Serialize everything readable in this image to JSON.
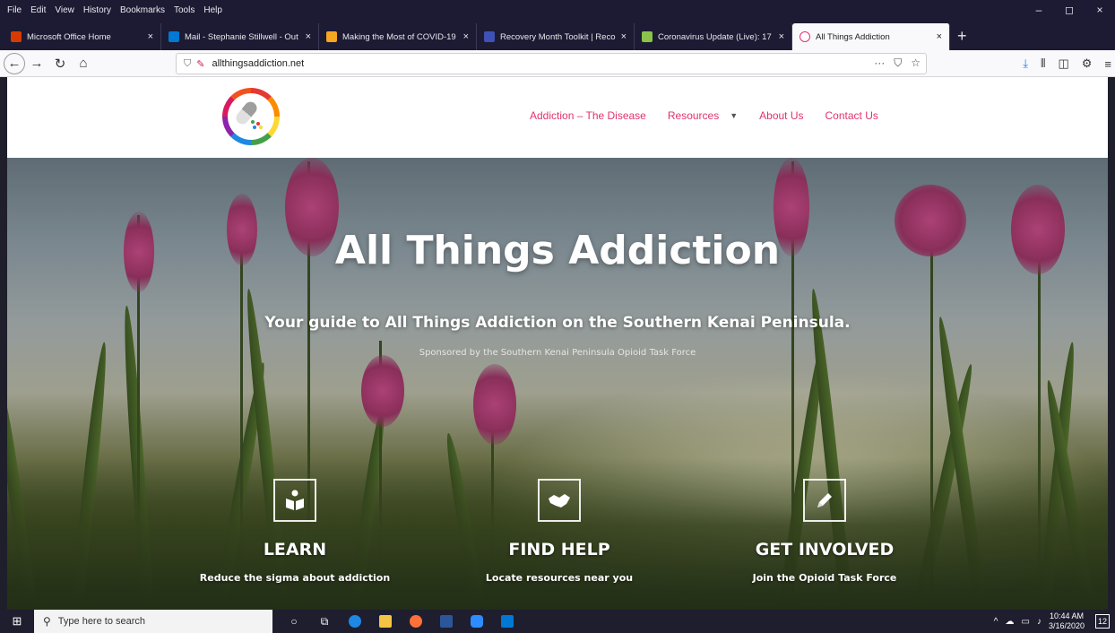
{
  "menubar": {
    "items": [
      "File",
      "Edit",
      "View",
      "History",
      "Bookmarks",
      "Tools",
      "Help"
    ],
    "controls": [
      "–",
      "◻",
      "×"
    ]
  },
  "tabs": [
    {
      "label": "Microsoft Office Home",
      "color": "#d83b01"
    },
    {
      "label": "Mail - Stephanie Stillwell - Out",
      "color": "#0078d4"
    },
    {
      "label": "Making the Most of COVID-19",
      "color": "#f5a623"
    },
    {
      "label": "Recovery Month Toolkit | Reco",
      "color": "#3f51b5"
    },
    {
      "label": "Coronavirus Update (Live): 17",
      "color": "#8bc34a"
    },
    {
      "label": "All Things Addiction",
      "color": "#ffffff",
      "active": true
    }
  ],
  "navbar": {
    "url": "allthingsaddiction.net",
    "url_right_icons": [
      "···",
      "⛉",
      "☆"
    ]
  },
  "site": {
    "nav": {
      "item1": "Addiction – The Disease",
      "item2": "Resources",
      "item3": "About Us",
      "item4": "Contact Us"
    },
    "hero": {
      "title": "All Things Addiction",
      "subtitle": "Your guide to All Things Addiction on the Southern Kenai Peninsula.",
      "sponsor": "Sponsored by the Southern Kenai Peninsula Opioid Task Force"
    },
    "features": [
      {
        "title": "LEARN",
        "desc": "Reduce the sigma about addiction",
        "icon": "book-reader-icon"
      },
      {
        "title": "FIND HELP",
        "desc": "Locate resources near you",
        "icon": "handshake-icon"
      },
      {
        "title": "GET INVOLVED",
        "desc": "Join the Opioid Task Force",
        "icon": "pencil-icon"
      }
    ],
    "accent_color": "#e0336d"
  },
  "taskbar": {
    "search_placeholder": "Type here to search",
    "time": "10:44 AM",
    "date": "3/16/2020",
    "notification_count": "12"
  }
}
